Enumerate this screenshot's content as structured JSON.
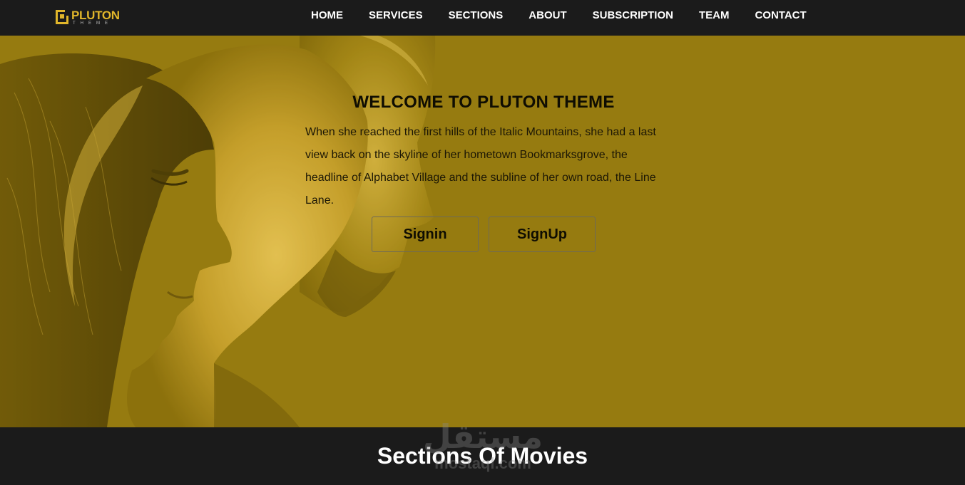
{
  "brand": {
    "name": "PLUTON",
    "tagline": "THEME"
  },
  "nav": {
    "items": [
      {
        "label": "HOME"
      },
      {
        "label": "SERVICES"
      },
      {
        "label": "SECTIONS"
      },
      {
        "label": "ABOUT"
      },
      {
        "label": "SUBSCRIPTION"
      },
      {
        "label": "TEAM"
      },
      {
        "label": "CONTACT"
      }
    ]
  },
  "hero": {
    "title": "WELCOME TO PLUTON THEME",
    "text": "When she reached the first hills of the Italic Mountains, she had a last view back on the skyline of her hometown Bookmarksgrove, the headline of Alphabet Village and the subline of her own road, the Line Lane.",
    "signin_label": "Signin",
    "signup_label": "SignUp"
  },
  "section": {
    "title": "Sections Of Movies"
  },
  "watermark": {
    "arabic": "مستقل",
    "latin": "mostaql.com"
  },
  "colors": {
    "accent": "#e1b62b",
    "hero_overlay": "#977c10",
    "dark": "#1b1b1b"
  }
}
